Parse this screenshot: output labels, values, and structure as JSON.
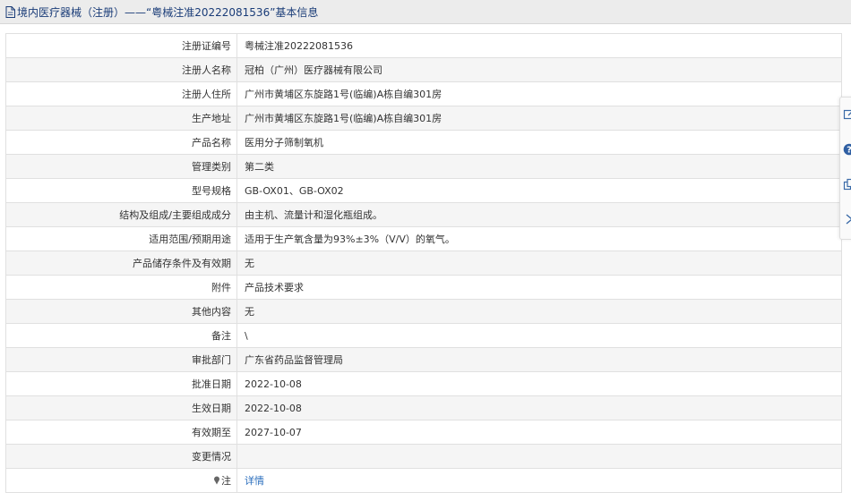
{
  "header": {
    "title": "境内医疗器械（注册）——“粤械注准20222081536”基本信息",
    "icon": "document-icon"
  },
  "rows": [
    {
      "label": "注册证编号",
      "value": "粤械注准20222081536"
    },
    {
      "label": "注册人名称",
      "value": "冠柏（广州）医疗器械有限公司"
    },
    {
      "label": "注册人住所",
      "value": "广州市黄埔区东旋路1号(临编)A栋自编301房"
    },
    {
      "label": "生产地址",
      "value": "广州市黄埔区东旋路1号(临编)A栋自编301房"
    },
    {
      "label": "产品名称",
      "value": "医用分子筛制氧机"
    },
    {
      "label": "管理类别",
      "value": "第二类"
    },
    {
      "label": "型号规格",
      "value": "GB-OX01、GB-OX02"
    },
    {
      "label": "结构及组成/主要组成成分",
      "value": "由主机、流量计和湿化瓶组成。"
    },
    {
      "label": "适用范围/预期用途",
      "value": "适用于生产氧含量为93%±3%（V/V）的氧气。"
    },
    {
      "label": "产品储存条件及有效期",
      "value": "无"
    },
    {
      "label": "附件",
      "value": "产品技术要求"
    },
    {
      "label": "其他内容",
      "value": "无"
    },
    {
      "label": "备注",
      "value": "\\"
    },
    {
      "label": "审批部门",
      "value": "广东省药品监督管理局"
    },
    {
      "label": "批准日期",
      "value": "2022-10-08"
    },
    {
      "label": "生效日期",
      "value": "2022-10-08"
    },
    {
      "label": "有效期至",
      "value": "2027-10-07"
    },
    {
      "label": "变更情况",
      "value": ""
    }
  ],
  "note_row": {
    "label": "注",
    "icon": "pin-icon",
    "link": "详情"
  },
  "side_tools": [
    "edit-icon",
    "help-icon",
    "copy-icon",
    "collapse-icon"
  ],
  "colors": {
    "header_text": "#1a3c78",
    "link": "#2a6ebd",
    "row_stripe": "#f5f5f5",
    "header_bg": "#ececec"
  }
}
